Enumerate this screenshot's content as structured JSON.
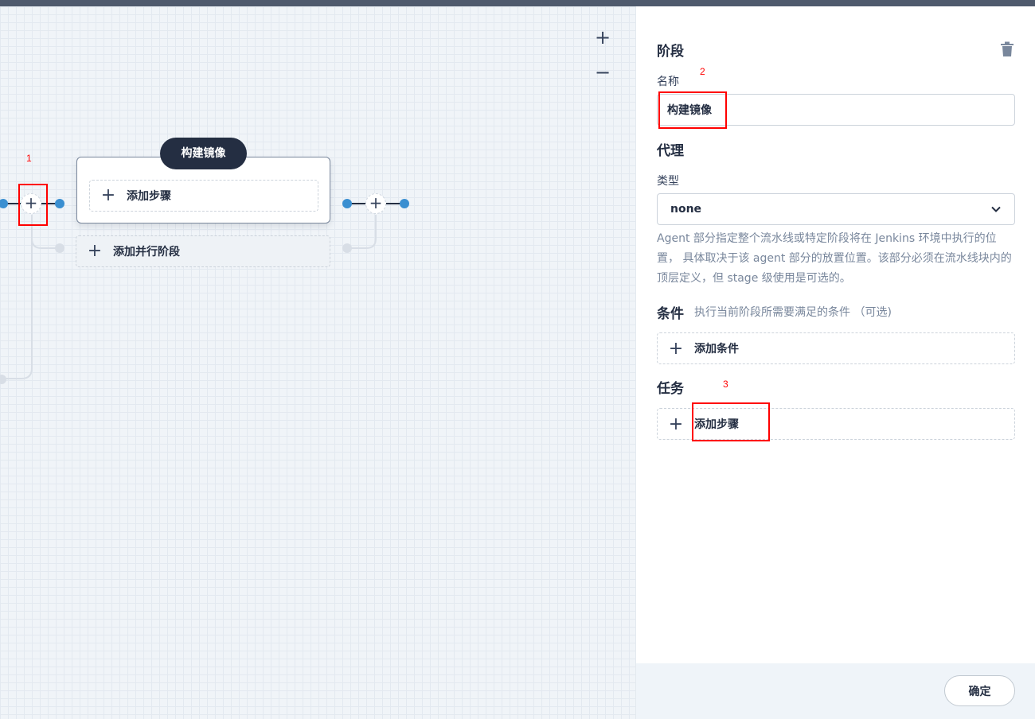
{
  "canvas": {
    "zoom_in": "+",
    "zoom_out": "−",
    "stage": {
      "title": "构建镜像",
      "add_step": "添加步骤",
      "add_parallel": "添加并行阶段"
    },
    "add_node_symbol": "+"
  },
  "panel": {
    "stage_heading": "阶段",
    "name_label": "名称",
    "name_value": "构建镜像",
    "agent_heading": "代理",
    "type_label": "类型",
    "type_value": "none",
    "agent_description": "Agent 部分指定整个流水线或特定阶段将在 Jenkins 环境中执行的位置， 具体取决于该 agent 部分的放置位置。该部分必须在流水线块内的顶层定义，但 stage 级使用是可选的。",
    "condition_heading": "条件",
    "condition_hint": "执行当前阶段所需要满足的条件 （可选)",
    "add_condition": "添加条件",
    "task_heading": "任务",
    "add_step": "添加步骤",
    "confirm": "确定"
  },
  "annotations": [
    "1",
    "2",
    "3"
  ],
  "colors": {
    "accent_blue": "#3a8fd1",
    "dark": "#242e42",
    "annotation_red": "#ff0000"
  }
}
